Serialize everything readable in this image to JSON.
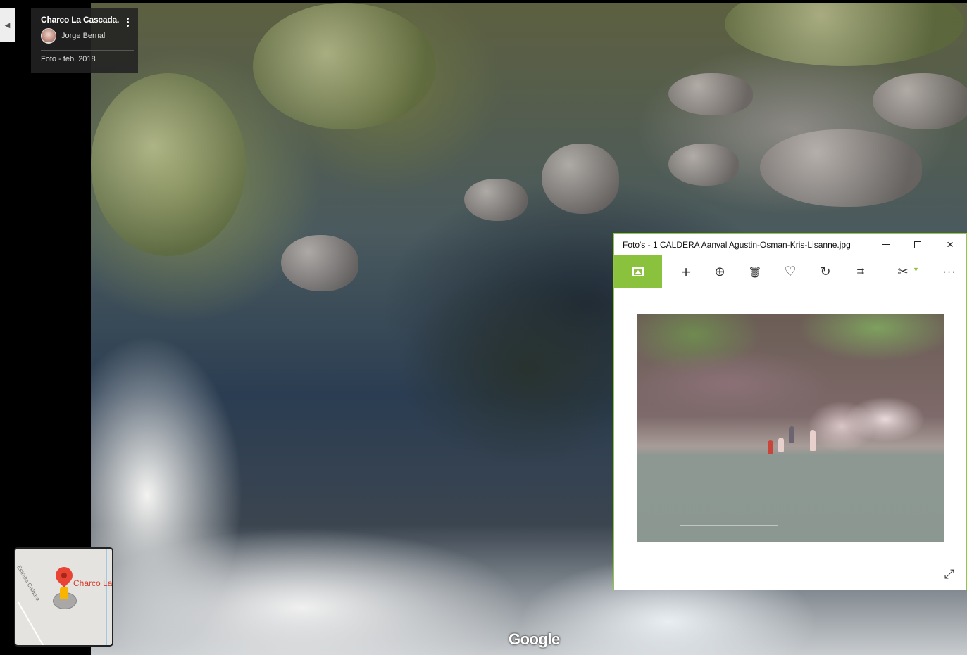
{
  "streetview": {
    "place_title": "Charco La Cascada.",
    "author_name": "Jorge Bernal",
    "photo_date": "Foto - feb. 2018",
    "google_logo": "Google",
    "collapse_icon": "caret-left-icon",
    "menu_icon": "more-vert-icon"
  },
  "minimap": {
    "road_label": "Estrella Caldera",
    "pin_label": "Charco La",
    "pin_color": "#e94335",
    "pegman_color": "#f7b500"
  },
  "photos_app": {
    "window_title": "Foto's - 1 CALDERA Aanval Agustin-Osman-Kris-Lisanne.jpg",
    "accent_color": "#8ac23e",
    "toolbar": [
      {
        "name": "image-icon"
      },
      {
        "name": "add-icon",
        "glyph": "+"
      },
      {
        "name": "zoom-icon",
        "glyph": "⊕"
      },
      {
        "name": "delete-icon",
        "glyph": "🗑"
      },
      {
        "name": "heart-icon",
        "glyph": "♡"
      },
      {
        "name": "rotate-icon",
        "glyph": "↻"
      },
      {
        "name": "crop-icon",
        "glyph": "⌗"
      },
      {
        "name": "edit-icon",
        "glyph": "✂"
      },
      {
        "name": "more-icon",
        "glyph": "···"
      }
    ],
    "window_controls": {
      "minimize": "minimize-icon",
      "maximize": "maximize-icon",
      "close": "×"
    },
    "expand_glyph": "⤢"
  }
}
